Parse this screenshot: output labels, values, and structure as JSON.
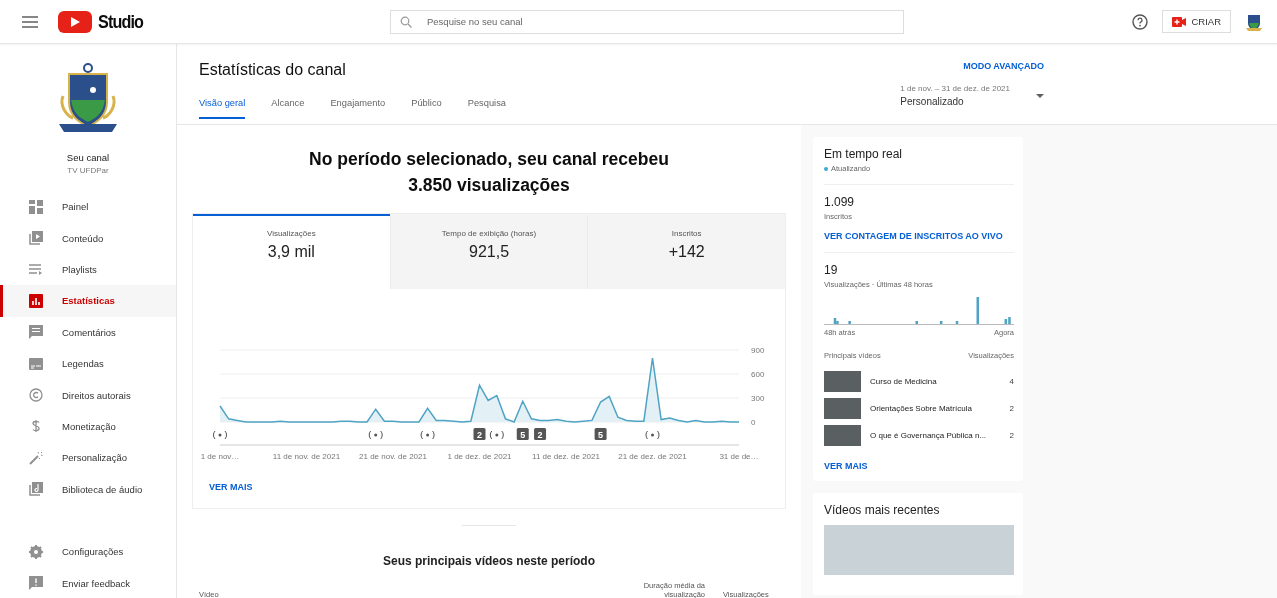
{
  "topbar": {
    "brand": "Studio",
    "search": {
      "placeholder": "Pesquise no seu canal"
    },
    "create_button": "CRIAR"
  },
  "sidebar": {
    "channel_label": "Seu canal",
    "channel_name": "TV UFDPar",
    "items": [
      {
        "label": "Painel",
        "selected": false
      },
      {
        "label": "Conteúdo",
        "selected": false
      },
      {
        "label": "Playlists",
        "selected": false
      },
      {
        "label": "Estatísticas",
        "selected": true
      },
      {
        "label": "Comentários",
        "selected": false
      },
      {
        "label": "Legendas",
        "selected": false
      },
      {
        "label": "Direitos autorais",
        "selected": false
      },
      {
        "label": "Monetização",
        "selected": false
      },
      {
        "label": "Personalização",
        "selected": false
      },
      {
        "label": "Biblioteca de áudio",
        "selected": false
      }
    ],
    "footer_items": [
      {
        "label": "Configurações"
      },
      {
        "label": "Enviar feedback"
      }
    ]
  },
  "header": {
    "title": "Estatísticas do canal",
    "advanced_mode": "MODO AVANÇADO",
    "date_range": "1 de nov. – 31 de dez. de 2021",
    "period": "Personalizado",
    "tabs": [
      {
        "label": "Visão geral",
        "selected": true
      },
      {
        "label": "Alcance",
        "selected": false
      },
      {
        "label": "Engajamento",
        "selected": false
      },
      {
        "label": "Público",
        "selected": false
      },
      {
        "label": "Pesquisa",
        "selected": false
      }
    ]
  },
  "overview": {
    "headline_line1": "No período selecionado, seu canal recebeu",
    "headline_line2": "3.850 visualizações",
    "metrics": [
      {
        "label": "Visualizações",
        "value": "3,9 mil",
        "selected": true
      },
      {
        "label": "Tempo de exibição (horas)",
        "value": "921,5",
        "selected": false
      },
      {
        "label": "Inscritos",
        "value": "+142",
        "selected": false
      }
    ],
    "chart_data": {
      "type": "area",
      "categories": [
        "1 de nov…",
        null,
        null,
        null,
        null,
        null,
        null,
        null,
        null,
        null,
        "11 de nov. de 2021",
        null,
        null,
        null,
        null,
        null,
        null,
        null,
        null,
        null,
        "21 de nov. de 2021",
        null,
        null,
        null,
        null,
        null,
        null,
        null,
        null,
        null,
        "1 de dez. de 2021",
        null,
        null,
        null,
        null,
        null,
        null,
        null,
        null,
        null,
        "11 de dez. de 2021",
        null,
        null,
        null,
        null,
        null,
        null,
        null,
        null,
        null,
        "21 de dez. de 2021",
        null,
        null,
        null,
        null,
        null,
        null,
        null,
        null,
        null,
        "31 de de…"
      ],
      "series": [
        {
          "color": "#4fa3c4",
          "values": [
            200,
            40,
            20,
            0,
            0,
            0,
            0,
            10,
            0,
            0,
            0,
            0,
            0,
            0,
            10,
            10,
            0,
            0,
            160,
            10,
            10,
            0,
            0,
            0,
            170,
            20,
            20,
            10,
            0,
            10,
            460,
            270,
            330,
            40,
            0,
            260,
            40,
            20,
            20,
            30,
            10,
            0,
            10,
            20,
            250,
            320,
            60,
            20,
            10,
            10,
            800,
            30,
            50,
            20,
            0,
            20,
            0,
            0,
            10,
            0,
            0
          ]
        }
      ],
      "ylim": [
        0,
        900
      ],
      "yticks": [
        0,
        300,
        600,
        900
      ]
    },
    "timeline_markers": [
      {
        "kind": "live"
      },
      {
        "kind": "none"
      },
      {
        "kind": "none"
      },
      {
        "kind": "none"
      },
      {
        "kind": "none"
      },
      {
        "kind": "none"
      },
      {
        "kind": "none"
      },
      {
        "kind": "none"
      },
      {
        "kind": "none"
      },
      {
        "kind": "none"
      },
      {
        "kind": "none"
      },
      {
        "kind": "none"
      },
      {
        "kind": "none"
      },
      {
        "kind": "none"
      },
      {
        "kind": "none"
      },
      {
        "kind": "none"
      },
      {
        "kind": "none"
      },
      {
        "kind": "none"
      },
      {
        "kind": "live"
      },
      {
        "kind": "none"
      },
      {
        "kind": "none"
      },
      {
        "kind": "none"
      },
      {
        "kind": "none"
      },
      {
        "kind": "none"
      },
      {
        "kind": "live"
      },
      {
        "kind": "none"
      },
      {
        "kind": "none"
      },
      {
        "kind": "none"
      },
      {
        "kind": "none"
      },
      {
        "kind": "none"
      },
      {
        "kind": "count",
        "label": "2"
      },
      {
        "kind": "none"
      },
      {
        "kind": "live"
      },
      {
        "kind": "none"
      },
      {
        "kind": "none"
      },
      {
        "kind": "count",
        "label": "5"
      },
      {
        "kind": "none"
      },
      {
        "kind": "count",
        "label": "2"
      },
      {
        "kind": "none"
      },
      {
        "kind": "none"
      },
      {
        "kind": "none"
      },
      {
        "kind": "none"
      },
      {
        "kind": "none"
      },
      {
        "kind": "none"
      },
      {
        "kind": "count",
        "label": "5"
      },
      {
        "kind": "none"
      },
      {
        "kind": "none"
      },
      {
        "kind": "none"
      },
      {
        "kind": "none"
      },
      {
        "kind": "none"
      },
      {
        "kind": "live"
      },
      {
        "kind": "none"
      },
      {
        "kind": "none"
      },
      {
        "kind": "none"
      },
      {
        "kind": "none"
      },
      {
        "kind": "none"
      },
      {
        "kind": "none"
      },
      {
        "kind": "none"
      },
      {
        "kind": "none"
      },
      {
        "kind": "none"
      },
      {
        "kind": "none"
      }
    ],
    "more_link": "VER MAIS"
  },
  "top_videos": {
    "title": "Seus principais vídeos neste período",
    "columns": [
      "Vídeo",
      "Duração média da visualização",
      "Visualizações"
    ]
  },
  "realtime": {
    "title": "Em tempo real",
    "status": "Atualizando",
    "subscribers": "1.099",
    "subscribers_label": "Inscritos",
    "live_count_link": "VER CONTAGEM DE INSCRITOS AO VIVO",
    "views": "19",
    "views_label": "Visualizações · Últimas 48 horas",
    "axis_start": "48h atrás",
    "axis_end": "Agora",
    "list_header": "Principais vídeos",
    "list_header_views": "Visualizações",
    "videos": [
      {
        "title": "Curso de Medicina",
        "views": "4"
      },
      {
        "title": "Orientações Sobre Matrícula",
        "views": "2"
      },
      {
        "title": "O que é Governança Pública n...",
        "views": "2"
      }
    ],
    "more_link": "VER MAIS"
  },
  "recent": {
    "title": "Vídeos mais recentes"
  }
}
